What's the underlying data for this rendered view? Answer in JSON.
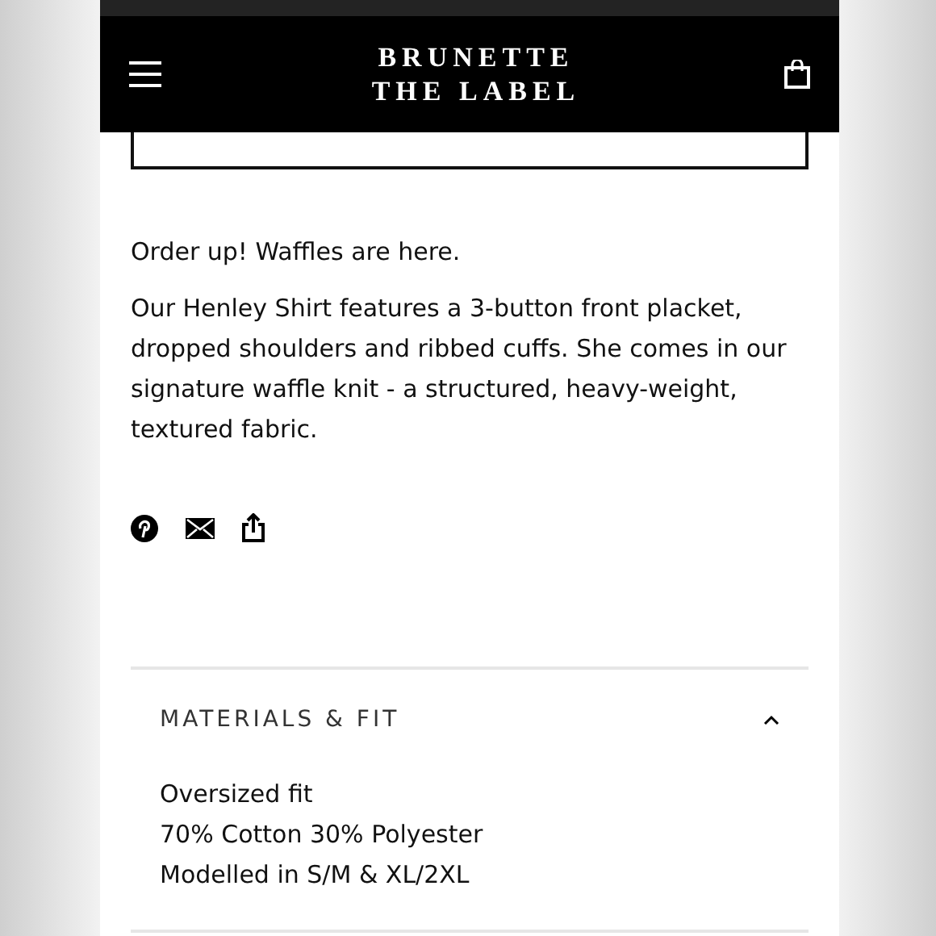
{
  "header": {
    "logo_lines": [
      "BRUNETTE",
      "THE LABEL"
    ]
  },
  "headline": "Order up! Waffles are here.",
  "description": "Our Henley Shirt features a 3-button front placket, dropped shoulders and ribbed cuffs. She comes in our signature waffle knit - a structured, heavy-weight, textured fabric.",
  "accordion": {
    "title": "MATERIALS & FIT",
    "expanded": true,
    "lines": [
      "Oversized fit",
      "70% Cotton 30% Polyester",
      "Modelled in S/M & XL/2XL"
    ]
  }
}
